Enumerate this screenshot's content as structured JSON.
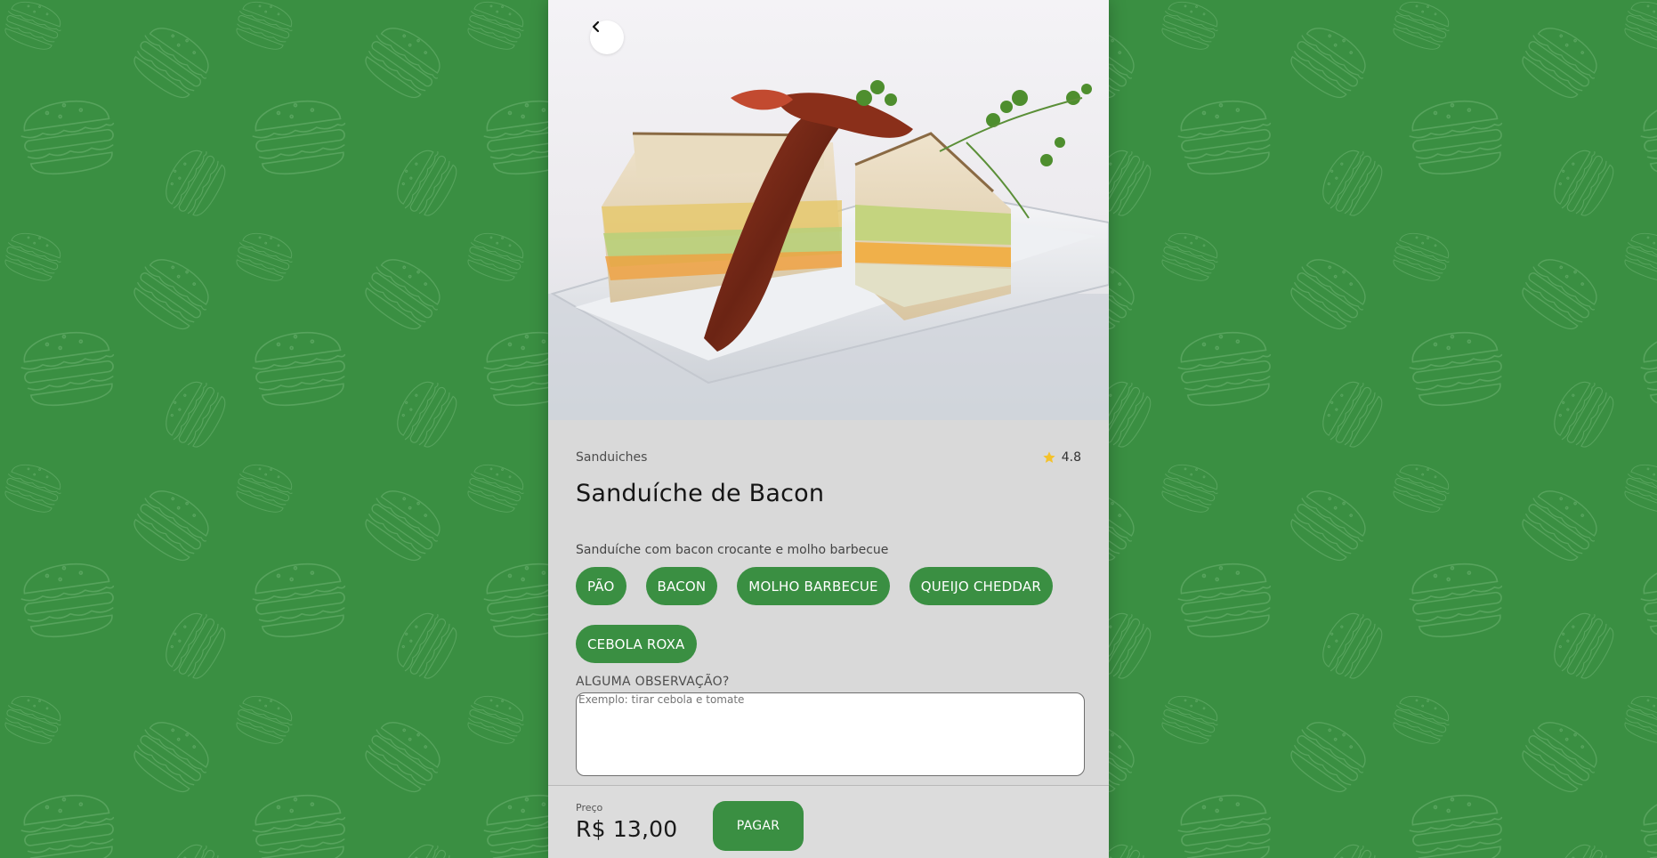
{
  "colors": {
    "brand_green": "#3a8f42",
    "card_bg": "#d9d9d9",
    "star": "#f4c22b"
  },
  "product": {
    "category": "Sanduiches",
    "rating": "4.8",
    "name": "Sanduíche de Bacon",
    "description": "Sanduíche com bacon crocante e molho barbecue",
    "ingredients": [
      "PÃO",
      "BACON",
      "MOLHO BARBECUE",
      "QUEIJO CHEDDAR",
      "CEBOLA ROXA"
    ]
  },
  "observation": {
    "label": "ALGUMA OBSERVAÇÃO?",
    "placeholder": "Exemplo: tirar cebola e tomate"
  },
  "footer": {
    "price_label": "Preço",
    "price_value": "R$ 13,00",
    "pay_label": "PAGAR"
  },
  "icons": {
    "back": "chevron-left-icon",
    "star": "star-icon",
    "background": "burger-pattern"
  }
}
